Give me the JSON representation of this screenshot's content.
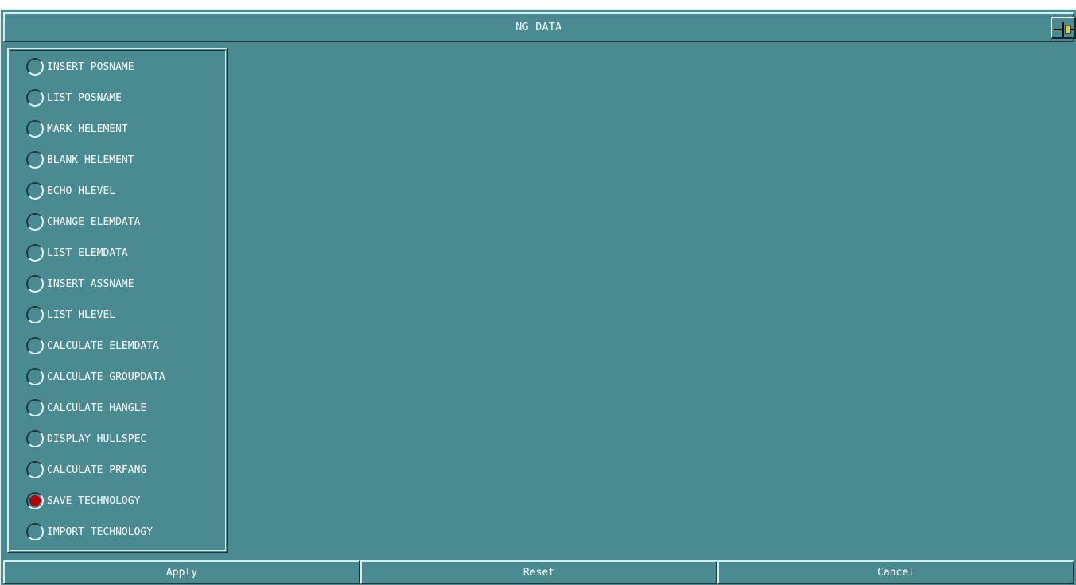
{
  "window": {
    "title": "NG DATA",
    "pin_icon": "pin-icon"
  },
  "options": [
    {
      "label": "INSERT POSNAME",
      "checked": false
    },
    {
      "label": "LIST POSNAME",
      "checked": false
    },
    {
      "label": "MARK HELEMENT",
      "checked": false
    },
    {
      "label": "BLANK HELEMENT",
      "checked": false
    },
    {
      "label": "ECHO HLEVEL",
      "checked": false
    },
    {
      "label": "CHANGE ELEMDATA",
      "checked": false
    },
    {
      "label": "LIST ELEMDATA",
      "checked": false
    },
    {
      "label": "INSERT ASSNAME",
      "checked": false
    },
    {
      "label": "LIST HLEVEL",
      "checked": false
    },
    {
      "label": "CALCULATE ELEMDATA",
      "checked": false
    },
    {
      "label": "CALCULATE GROUPDATA",
      "checked": false
    },
    {
      "label": "CALCULATE HANGLE",
      "checked": false
    },
    {
      "label": "DISPLAY HULLSPEC",
      "checked": false
    },
    {
      "label": "CALCULATE PRFANG",
      "checked": false
    },
    {
      "label": "SAVE TECHNOLOGY",
      "checked": true
    },
    {
      "label": "IMPORT TECHNOLOGY",
      "checked": false
    }
  ],
  "buttons": {
    "apply": "Apply",
    "reset": "Reset",
    "cancel": "Cancel"
  },
  "colors": {
    "background": "#4a8a91",
    "selected_radio": "#b30000"
  }
}
